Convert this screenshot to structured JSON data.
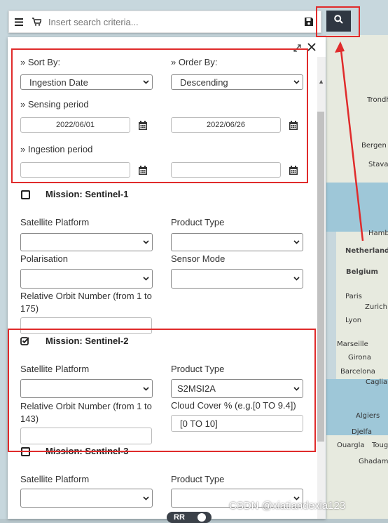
{
  "toolbar": {
    "search_placeholder": "Insert search criteria...",
    "menu_icon": "hamburger-icon",
    "cart_icon": "cart-icon",
    "save_icon": "save-icon",
    "search_icon": "search-icon"
  },
  "panel": {
    "sort_by_label": "» Sort By:",
    "sort_by_value": "Ingestion Date",
    "order_by_label": "» Order By:",
    "order_by_value": "Descending",
    "sensing_label": "» Sensing period",
    "sensing_from": "2022/06/01",
    "sensing_to": "2022/06/26",
    "ingestion_label": "» Ingestion period",
    "ingestion_from": "",
    "ingestion_to": "",
    "s1": {
      "title": "Mission: Sentinel-1",
      "checked": false,
      "satellite_platform_label": "Satellite Platform",
      "product_type_label": "Product Type",
      "polarisation_label": "Polarisation",
      "sensor_mode_label": "Sensor Mode",
      "orbit_label": "Relative Orbit Number (from 1 to 175)"
    },
    "s2": {
      "title": "Mission: Sentinel-2",
      "checked": true,
      "satellite_platform_label": "Satellite Platform",
      "product_type_label": "Product Type",
      "product_type_value": "S2MSI2A",
      "orbit_label": "Relative Orbit Number (from 1 to 143)",
      "cloud_label": "Cloud Cover % (e.g.[0 TO 9.4])",
      "cloud_value": "[0 TO 10]"
    },
    "s3": {
      "title": "Mission: Sentinel-3",
      "checked": false,
      "satellite_platform_label": "Satellite Platform",
      "product_type_label": "Product Type"
    }
  },
  "map_labels": [
    "Trondho",
    "Bergen",
    "Stava",
    "Hambu",
    "Netherlands",
    "Belgium",
    "Paris",
    "Zurich",
    "Lyon",
    "Marseille",
    "Girona",
    "Barcelona",
    "Cagliar",
    "Algiers",
    "Djelfa",
    "Ouargla",
    "Tougg",
    "Ghadame"
  ],
  "bottom_toggle": "RR",
  "watermark": "CSDN @xiatiandexia123"
}
